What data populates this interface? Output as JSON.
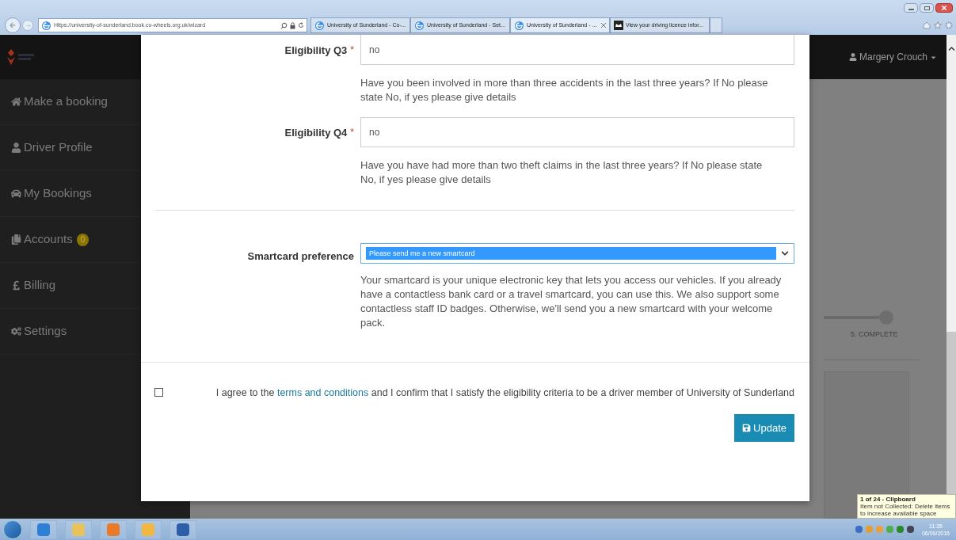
{
  "browser": {
    "url": "Https://university-of-sunderland.book.co-wheels.org.uk/wizard",
    "tabs": [
      {
        "title": "University of Sunderland - Co-...",
        "selected": false
      },
      {
        "title": "University of Sunderland - Set...",
        "selected": false
      },
      {
        "title": "University of Sunderland - ...",
        "selected": true
      },
      {
        "title": "View your driving licence infor...",
        "selected": false
      }
    ]
  },
  "sidebar": {
    "items": [
      {
        "label": "Make a booking"
      },
      {
        "label": "Driver Profile"
      },
      {
        "label": "My Bookings"
      },
      {
        "label": "Accounts",
        "badge": "0"
      },
      {
        "label": "Billing"
      },
      {
        "label": "Settings"
      }
    ]
  },
  "header": {
    "user": "Margery Crouch"
  },
  "stepper": {
    "step": "5. COMPLETE"
  },
  "modal": {
    "required_mark": "*",
    "questions": [
      {
        "label": "Eligibility Q3",
        "required": true,
        "value": "no",
        "help": "Have you been involved in more than three accidents in the last three years? If No please state No, if yes please give details"
      },
      {
        "label": "Eligibility Q4",
        "required": true,
        "value": "no",
        "help": "Have you have had more than two theft claims in the last three years? If No please state No, if yes please give details"
      }
    ],
    "smartcard": {
      "label": "Smartcard preference",
      "value": "Please send me a new smartcard",
      "help": "Your smartcard is your unique electronic key that lets you access our vehicles. If you already have a contactless bank card or a travel smartcard, you can use this. We also support some contactless staff ID badges. Otherwise, we'll send you a new smartcard with your welcome pack."
    },
    "agreement": {
      "checked": false,
      "before": "I agree to the",
      "link": "terms and conditions",
      "after": "and I confirm that I satisfy the eligibility criteria to be a driver member of University of Sunderland"
    },
    "button": "Update"
  },
  "taskbar": {
    "time": "11:35",
    "date": "06/09/2016"
  },
  "notification": {
    "title": "1 of 24 - Clipboard",
    "lines": [
      "Item not Collected: Delete items",
      "to increase available space"
    ]
  }
}
